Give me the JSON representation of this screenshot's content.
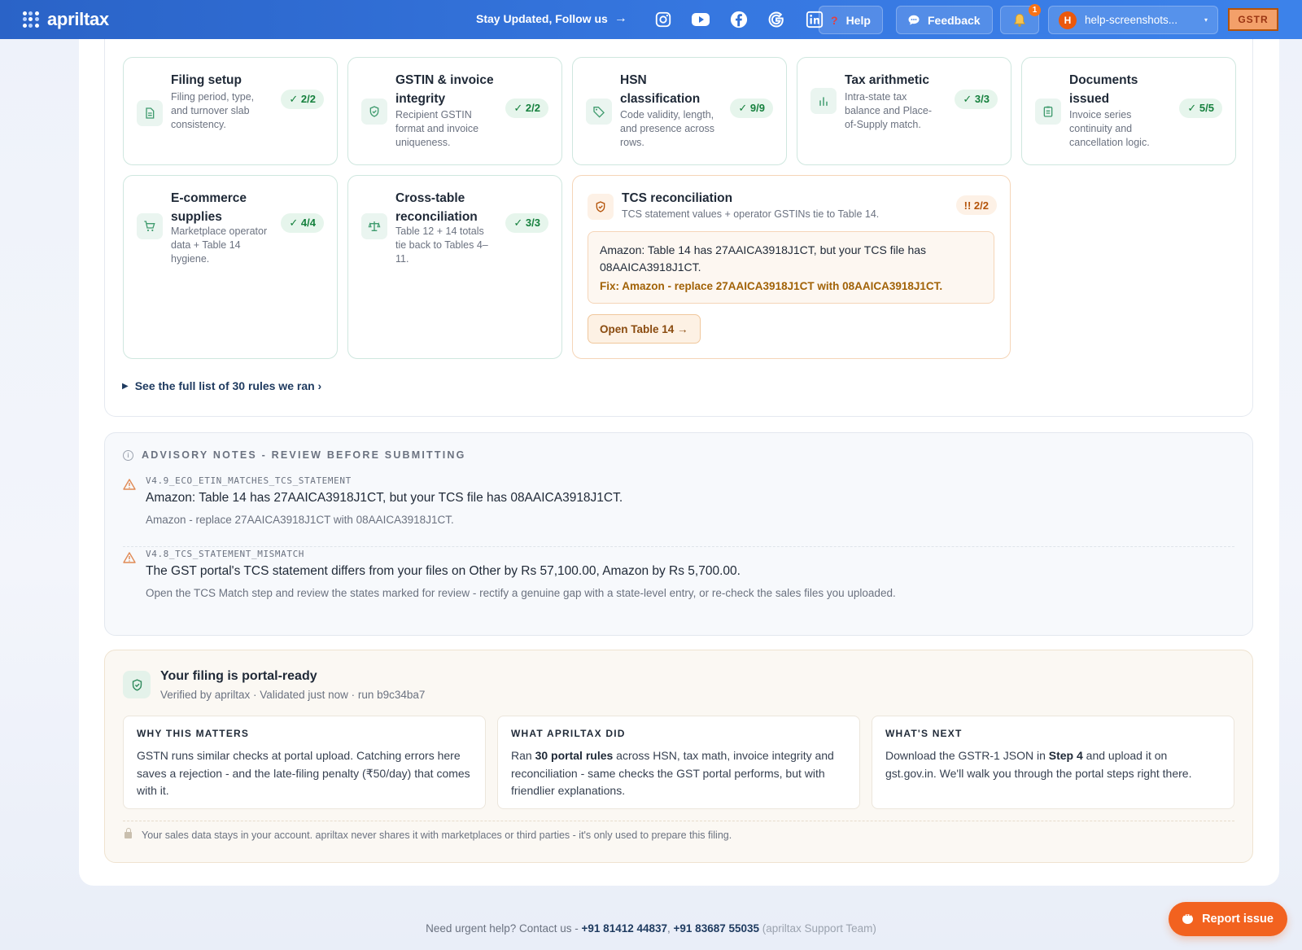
{
  "header": {
    "brand": "apriltax",
    "follow_label": "Stay Updated, Follow us",
    "social": [
      "instagram-icon",
      "youtube-icon",
      "facebook-icon",
      "google-icon",
      "linkedin-icon"
    ],
    "help_label": "Help",
    "help_icon_glyph": "?",
    "feedback_label": "Feedback",
    "notification_count": "1",
    "account_initial": "H",
    "account_label": "help-screenshots...",
    "gstr_label": "GSTR",
    "colors": {
      "bar": "#2f6fd6",
      "accent": "#f97316"
    }
  },
  "rules": {
    "cards": [
      {
        "title": "Filing setup",
        "desc": "Filing period, type, and turnover slab consistency.",
        "badge": "✓ 2/2",
        "icon": "document-icon"
      },
      {
        "title": "GSTIN & invoice integrity",
        "desc": "Recipient GSTIN format and invoice uniqueness.",
        "badge": "✓ 2/2",
        "icon": "shield-icon"
      },
      {
        "title": "HSN classification",
        "desc": "Code validity, length, and presence across rows.",
        "badge": "✓ 9/9",
        "icon": "tag-icon"
      },
      {
        "title": "Tax arithmetic",
        "desc": "Intra-state tax balance and Place-of-Supply match.",
        "badge": "✓ 3/3",
        "icon": "bar-chart-icon"
      },
      {
        "title": "Documents issued",
        "desc": "Invoice series continuity and cancellation logic.",
        "badge": "✓ 5/5",
        "icon": "clipboard-icon"
      },
      {
        "title": "E-commerce supplies",
        "desc": "Marketplace operator data + Table 14 hygiene.",
        "badge": "✓ 4/4",
        "icon": "cart-icon"
      },
      {
        "title": "Cross-table reconciliation",
        "desc": "Table 12 + 14 totals tie back to Tables 4–11.",
        "badge": "✓ 3/3",
        "icon": "scale-icon"
      }
    ],
    "tcs": {
      "title": "TCS reconciliation",
      "desc": "TCS statement values + operator GSTINs tie to Table 14.",
      "badge": "!! 2/2",
      "message": "Amazon: Table 14 has 27AAICA3918J1CT, but your TCS file has 08AAICA3918J1CT.",
      "fix": "Fix: Amazon - replace 27AAICA3918J1CT with 08AAICA3918J1CT.",
      "button": "Open Table 14 →"
    },
    "see_all": "See the full list of 30 rules we ran ›"
  },
  "advisory": {
    "heading": "ADVISORY NOTES - REVIEW BEFORE SUBMITTING",
    "items": [
      {
        "code": "V4.9_ECO_ETIN_MATCHES_TCS_STATEMENT",
        "message": "Amazon: Table 14 has 27AAICA3918J1CT, but your TCS file has 08AAICA3918J1CT.",
        "sub": "Amazon - replace 27AAICA3918J1CT with 08AAICA3918J1CT."
      },
      {
        "code": "V4.8_TCS_STATEMENT_MISMATCH",
        "message": "The GST portal's TCS statement differs from your files on Other by Rs 57,100.00, Amazon by Rs 5,700.00.",
        "sub": "Open the TCS Match step and review the states marked for review - rectify a genuine gap with a state-level entry, or re-check the sales files you uploaded."
      }
    ]
  },
  "ready": {
    "title": "Your filing is portal-ready",
    "subtitle": "Verified by apriltax · Validated just now · run b9c34ba7",
    "why_title": "WHY THIS MATTERS",
    "why_text": "GSTN runs similar checks at portal upload. Catching errors here saves a rejection - and the late-filing penalty (₹50/day) that comes with it.",
    "did_title": "WHAT APRILTAX DID",
    "did_pre": "Ran ",
    "did_bold": "30 portal rules",
    "did_post": " across HSN, tax math, invoice integrity and reconciliation - same checks the GST portal performs, but with friendlier explanations.",
    "next_title": "WHAT'S NEXT",
    "next_pre": "Download the GSTR-1 JSON in ",
    "next_bold": "Step 4",
    "next_post": " and upload it on gst.gov.in. We'll walk you through the portal steps right there.",
    "privacy": "Your sales data stays in your account. apriltax never shares it with marketplaces or third parties - it's only used to prepare this filing."
  },
  "footer": {
    "prefix": "Need urgent help? Contact us - ",
    "phone1": "+91 81412 44837",
    "sep": ", ",
    "phone2": "+91 83687 55035",
    "suffix": " (apriltax Support Team)"
  },
  "report_label": "Report issue"
}
